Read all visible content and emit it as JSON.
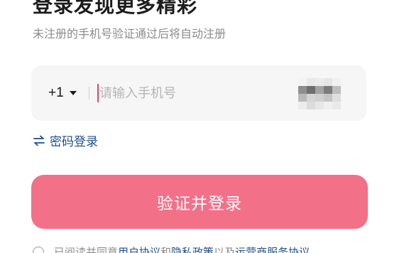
{
  "header": {
    "title": "登录发现更多精彩",
    "subtitle": "未注册的手机号验证通过后将自动注册"
  },
  "phone": {
    "country_code": "+1",
    "placeholder": "请输入手机号",
    "value": ""
  },
  "switch_login": {
    "label": "密码登录",
    "icon": "swap-arrows-icon"
  },
  "submit": {
    "label": "验证并登录"
  },
  "agreement": {
    "prefix": "已阅读并同意",
    "link_user": "用户协议",
    "and": "和",
    "link_privacy": "隐私政策",
    "and2": "以及",
    "link_carrier": "运营商服务协议"
  },
  "colors": {
    "primary_button": "#f27189",
    "link": "#1f4f8c",
    "cursor": "#e0465e"
  }
}
